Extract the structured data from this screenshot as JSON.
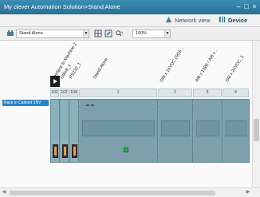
{
  "window": {
    "title": "My clever Automation Solution>Stand Alone",
    "controls": [
      "minimize-icon",
      "restore-icon",
      "close-icon"
    ]
  },
  "views": {
    "network_label": "Network view",
    "device_label": "Device view",
    "active": "Device view"
  },
  "toolbar": {
    "device_select": "Stand Alone",
    "zoom_value": "100%"
  },
  "slot_labels": [
    "Interface to Machine 2",
    "DI8x8_1",
    "RS232_1",
    "Stand Alone",
    "DI8 x 24VDC (SO5...",
    "AI8 x 13Bit / AI8 x ...",
    "DI8 x 24VDC_1"
  ],
  "slot_headers": [
    "102",
    "102",
    "104",
    "1",
    "2",
    "3",
    "4"
  ],
  "rack_link": "Rack in Cabinet 1NV",
  "colors": {
    "title_bar": "#2f7fa5",
    "module": "#7ea0ac",
    "status_led": "#2ab94c"
  }
}
